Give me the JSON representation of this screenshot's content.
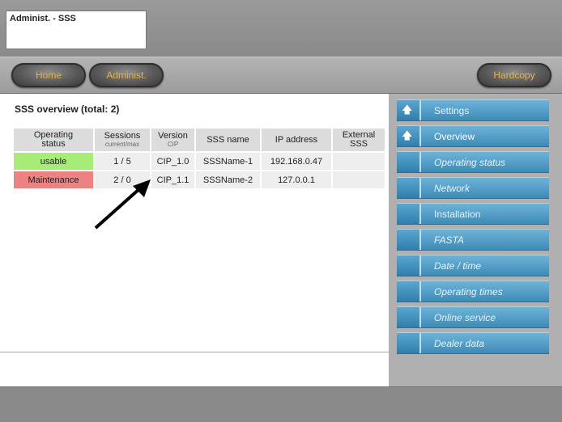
{
  "header": {
    "title": "Administ. - SSS"
  },
  "nav": {
    "home": "Home",
    "admin": "Administ.",
    "hardcopy": "Hardcopy"
  },
  "main": {
    "title": "SSS overview (total: 2)",
    "table": {
      "headers": [
        {
          "line1": "Operating",
          "line2": "status",
          "sub": ""
        },
        {
          "line1": "Sessions",
          "line2": "",
          "sub": "current/max"
        },
        {
          "line1": "Version",
          "line2": "",
          "sub": "CIP"
        },
        {
          "line1": "SSS name",
          "line2": "",
          "sub": ""
        },
        {
          "line1": "IP address",
          "line2": "",
          "sub": ""
        },
        {
          "line1": "External",
          "line2": "SSS",
          "sub": ""
        }
      ],
      "rows": [
        {
          "status": "usable",
          "sessions": "1 / 5",
          "version": "CIP_1.0",
          "name": "SSSName-1",
          "ip": "192.168.0.47",
          "external": ""
        },
        {
          "status": "Maintenance",
          "sessions": "2 / 0",
          "version": "CIP_1.1",
          "name": "SSSName-2",
          "ip": "127.0.0.1",
          "external": ""
        }
      ]
    }
  },
  "sidebar": {
    "items": [
      {
        "label": "Settings",
        "icon": "arrow-up-icon"
      },
      {
        "label": "Overview",
        "icon": "arrow-up-icon"
      },
      {
        "label": "Operating status"
      },
      {
        "label": "Network"
      },
      {
        "label": "Installation"
      },
      {
        "label": "FASTA"
      },
      {
        "label": "Date / time"
      },
      {
        "label": "Operating times"
      },
      {
        "label": "Online service"
      },
      {
        "label": "Dealer data"
      }
    ]
  },
  "colors": {
    "usable": "#a8ec78",
    "maintenance": "#ec8282",
    "menu": "#4a9ac6",
    "button_text": "#e3b34a"
  }
}
